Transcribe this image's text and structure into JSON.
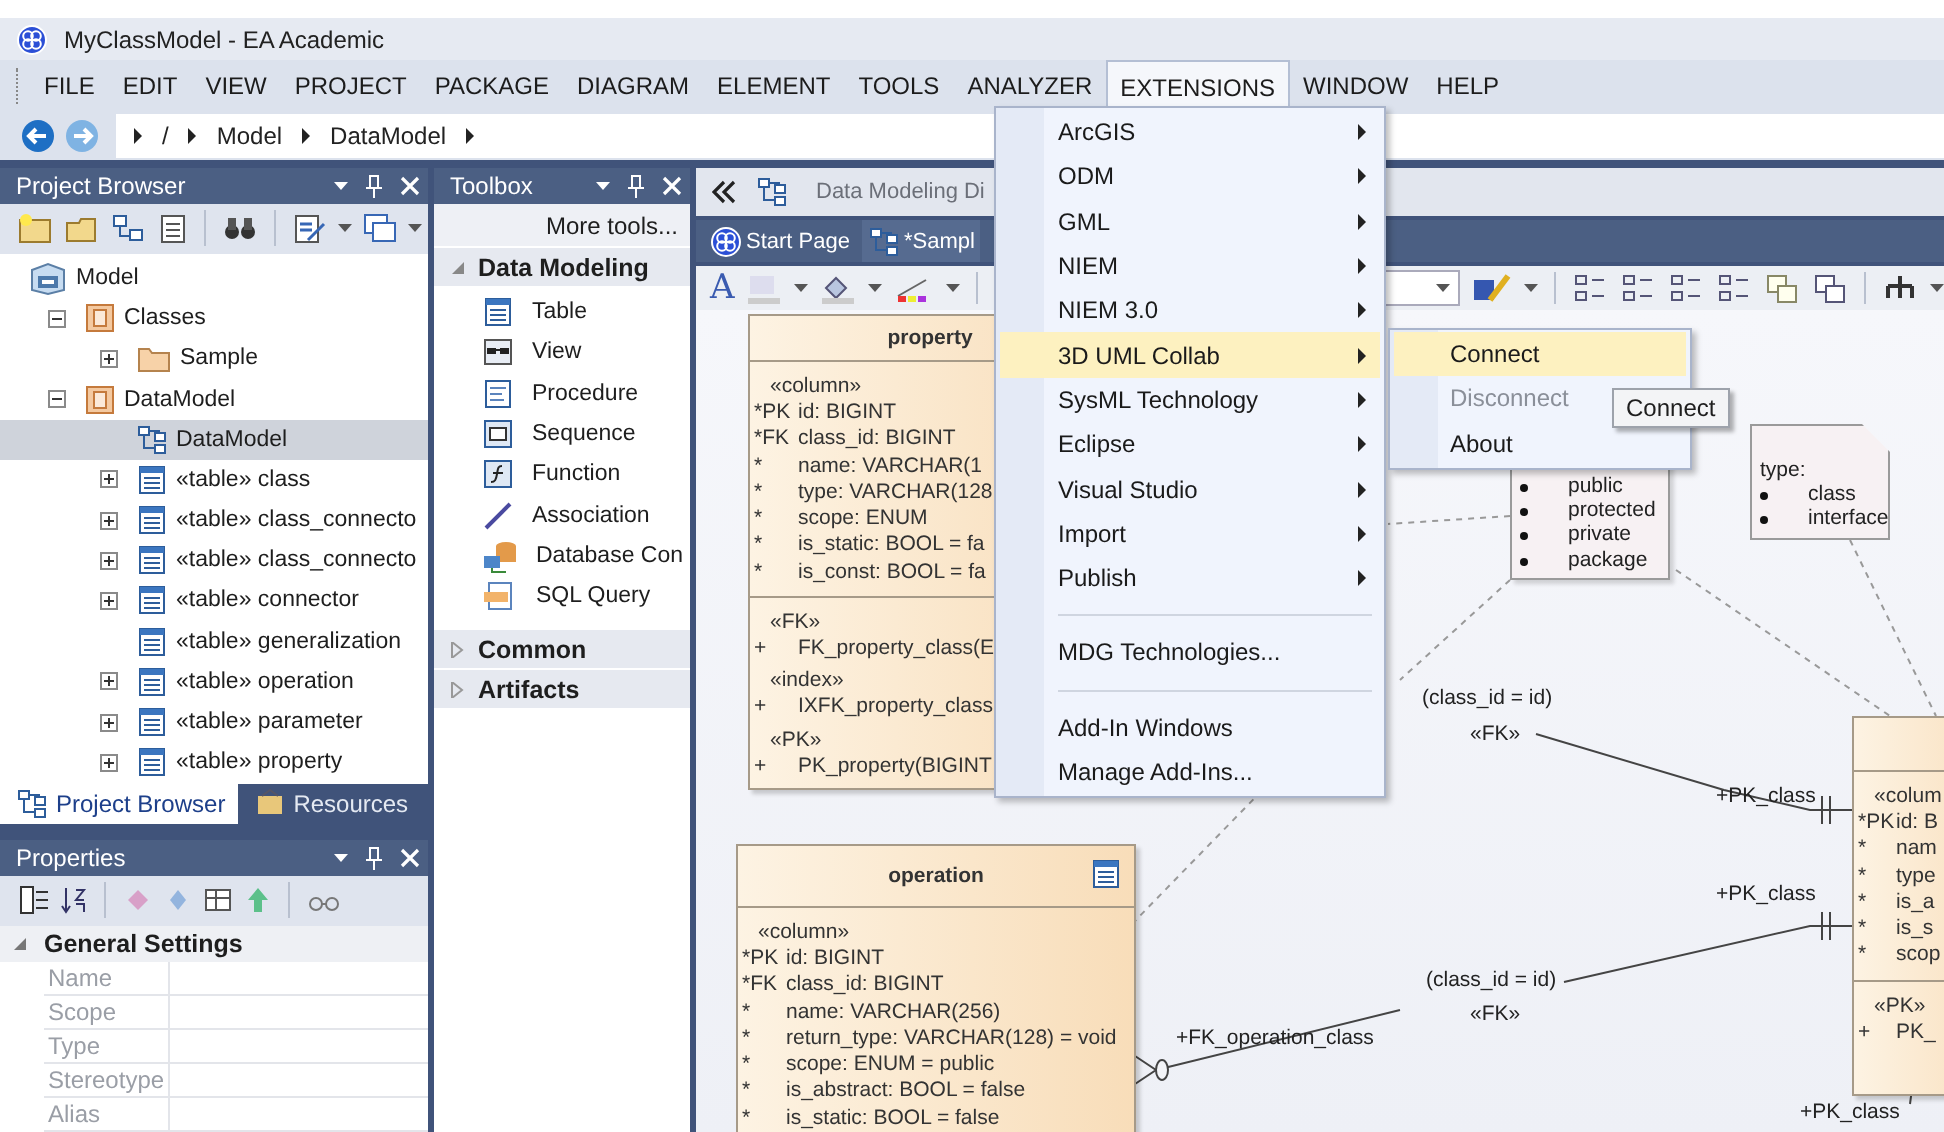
{
  "window": {
    "title": "MyClassModel - EA Academic"
  },
  "menu_bar": [
    {
      "label": "FILE",
      "selected": false
    },
    {
      "label": "EDIT",
      "selected": false
    },
    {
      "label": "VIEW",
      "selected": false
    },
    {
      "label": "PROJECT",
      "selected": false
    },
    {
      "label": "PACKAGE",
      "selected": false
    },
    {
      "label": "DIAGRAM",
      "selected": false
    },
    {
      "label": "ELEMENT",
      "selected": false
    },
    {
      "label": "TOOLS",
      "selected": false
    },
    {
      "label": "ANALYZER",
      "selected": false
    },
    {
      "label": "EXTENSIONS",
      "selected": true
    },
    {
      "label": "WINDOW",
      "selected": false
    },
    {
      "label": "HELP",
      "selected": false
    }
  ],
  "breadcrumb": [
    "/",
    "Model",
    "DataModel"
  ],
  "project_browser": {
    "title": "Project Browser",
    "tree": [
      {
        "label": "Model",
        "kind": "model",
        "selected": false,
        "children": [
          {
            "label": "Classes",
            "kind": "package",
            "expanded": true,
            "selected": false,
            "children": [
              {
                "label": "Sample",
                "kind": "folder",
                "expanded": false,
                "selected": false
              }
            ]
          },
          {
            "label": "DataModel",
            "kind": "package",
            "expanded": true,
            "selected": false,
            "children": [
              {
                "label": "DataModel",
                "kind": "diagram",
                "selected": true
              },
              {
                "label": "«table» class",
                "kind": "table",
                "expanded": false,
                "selected": false
              },
              {
                "label": "«table» class_connecto",
                "kind": "table",
                "expanded": false,
                "selected": false
              },
              {
                "label": "«table» class_connecto",
                "kind": "table",
                "expanded": false,
                "selected": false
              },
              {
                "label": "«table» connector",
                "kind": "table",
                "expanded": false,
                "selected": false
              },
              {
                "label": "«table» generalization",
                "kind": "table",
                "selected": false
              },
              {
                "label": "«table» operation",
                "kind": "table",
                "expanded": false,
                "selected": false
              },
              {
                "label": "«table» parameter",
                "kind": "table",
                "expanded": false,
                "selected": false
              },
              {
                "label": "«table» property",
                "kind": "table",
                "expanded": false,
                "selected": false
              }
            ]
          }
        ]
      }
    ],
    "tabs": [
      {
        "label": "Project Browser",
        "selected": true
      },
      {
        "label": "Resources",
        "selected": false
      }
    ]
  },
  "properties": {
    "title": "Properties",
    "group": {
      "label": "General Settings",
      "expanded": true
    },
    "rows": [
      {
        "label": "Name",
        "disabled": true
      },
      {
        "label": "Scope",
        "disabled": true
      },
      {
        "label": "Type",
        "disabled": true
      },
      {
        "label": "Stereotype",
        "disabled": true
      },
      {
        "label": "Alias",
        "disabled": true
      }
    ]
  },
  "toolbox": {
    "title": "Toolbox",
    "more": "More tools...",
    "groups": [
      {
        "label": "Data Modeling",
        "expanded": true,
        "items": [
          {
            "label": "Table",
            "kind": "table"
          },
          {
            "label": "View",
            "kind": "view"
          },
          {
            "label": "Procedure",
            "kind": "procedure"
          },
          {
            "label": "Sequence",
            "kind": "sequence"
          },
          {
            "label": "Function",
            "kind": "function"
          },
          {
            "label": "Association",
            "kind": "association"
          },
          {
            "label": "Database Con",
            "kind": "database"
          },
          {
            "label": "SQL Query",
            "kind": "sql"
          }
        ]
      },
      {
        "label": "Common",
        "expanded": false
      },
      {
        "label": "Artifacts",
        "expanded": false
      }
    ]
  },
  "diagram": {
    "header": "Data Modeling Di",
    "tabs": [
      {
        "label": "Start Page",
        "kind": "start",
        "selected": false
      },
      {
        "label": "*Sampl",
        "kind": "diagram",
        "selected": true
      }
    ],
    "font_button": "A",
    "tables": [
      {
        "name": "property",
        "compartments": [
          [
            {
              "stereotype": "«column»",
              "rows": [
                {
                  "key": "*PK",
                  "text": "id: BIGINT"
                },
                {
                  "key": "*FK",
                  "text": "class_id: BIGINT"
                },
                {
                  "key": "*",
                  "text": "name: VARCHAR(1"
                },
                {
                  "key": "*",
                  "text": "type: VARCHAR(128"
                },
                {
                  "key": "*",
                  "text": "scope: ENUM"
                },
                {
                  "key": "*",
                  "text": "is_static: BOOL = fa"
                },
                {
                  "key": "*",
                  "text": "is_const: BOOL = fa"
                }
              ]
            }
          ],
          [
            {
              "stereotype": "«FK»",
              "rows": [
                {
                  "key": "+",
                  "text": "FK_property_class(E"
                }
              ]
            },
            {
              "stereotype": "«index»",
              "rows": [
                {
                  "key": "+",
                  "text": "IXFK_property_class"
                }
              ]
            },
            {
              "stereotype": "«PK»",
              "rows": [
                {
                  "key": "+",
                  "text": "PK_property(BIGINT"
                }
              ]
            }
          ]
        ]
      },
      {
        "name": "operation",
        "icon": true,
        "compartments": [
          [
            {
              "stereotype": "«column»",
              "rows": [
                {
                  "key": "*PK",
                  "text": "id: BIGINT"
                },
                {
                  "key": "*FK",
                  "text": "class_id: BIGINT"
                },
                {
                  "key": "*",
                  "text": "name: VARCHAR(256)"
                },
                {
                  "key": "*",
                  "text": "return_type: VARCHAR(128) = void"
                },
                {
                  "key": "*",
                  "text": "scope: ENUM = public"
                },
                {
                  "key": "*",
                  "text": "is_abstract: BOOL = false"
                },
                {
                  "key": "*",
                  "text": "is_static: BOOL = false"
                }
              ]
            }
          ]
        ]
      },
      {
        "compartments": [
          [
            {
              "stereotype": "«colum",
              "rows": [
                {
                  "key": "*PK",
                  "text": "id: B"
                },
                {
                  "key": "*",
                  "text": "nam"
                },
                {
                  "key": "*",
                  "text": "type"
                },
                {
                  "key": "*",
                  "text": "is_a"
                },
                {
                  "key": "*",
                  "text": "is_s"
                },
                {
                  "key": "*",
                  "text": "scop"
                }
              ]
            }
          ],
          [
            {
              "stereotype": "«PK»",
              "rows": [
                {
                  "key": "+",
                  "text": "PK_"
                }
              ]
            }
          ]
        ]
      }
    ],
    "notes": [
      {
        "items": [
          "public",
          "protected",
          "private",
          "package"
        ]
      },
      {
        "heading": "type:",
        "items": [
          "class",
          "interface"
        ]
      }
    ],
    "connector_labels": [
      "(class_id = id)",
      "«FK»",
      "+PK_class",
      "+PK_class",
      "(class_id = id)",
      "«FK»",
      "+FK_operation_class",
      "+PK_class"
    ]
  },
  "extensions_menu": {
    "groups": [
      [
        {
          "label": "ArcGIS",
          "kind": "submenu",
          "highlighted": false
        },
        {
          "label": "ODM",
          "kind": "submenu",
          "highlighted": false
        },
        {
          "label": "GML",
          "kind": "submenu",
          "highlighted": false
        },
        {
          "label": "NIEM",
          "kind": "submenu",
          "highlighted": false
        },
        {
          "label": "NIEM 3.0",
          "kind": "submenu",
          "highlighted": false
        },
        {
          "label": "3D UML Collab",
          "kind": "submenu",
          "highlighted": true
        },
        {
          "label": "SysML Technology",
          "kind": "submenu",
          "highlighted": false
        },
        {
          "label": "Eclipse",
          "kind": "submenu",
          "highlighted": false
        },
        {
          "label": "Visual Studio",
          "kind": "submenu",
          "highlighted": false
        },
        {
          "label": "Import",
          "kind": "submenu",
          "highlighted": false
        },
        {
          "label": "Publish",
          "kind": "submenu",
          "highlighted": false
        }
      ],
      [
        {
          "label": "MDG Technologies...",
          "kind": "item",
          "highlighted": false
        }
      ],
      [
        {
          "label": "Add-In Windows",
          "kind": "item",
          "highlighted": false
        },
        {
          "label": "Manage Add-Ins...",
          "kind": "item",
          "highlighted": false
        }
      ]
    ],
    "submenu": [
      {
        "label": "Connect",
        "highlighted": true,
        "disabled": false
      },
      {
        "label": "Disconnect",
        "highlighted": false,
        "disabled": true
      },
      {
        "label": "About",
        "highlighted": false,
        "disabled": false
      }
    ],
    "tooltip": "Connect"
  }
}
